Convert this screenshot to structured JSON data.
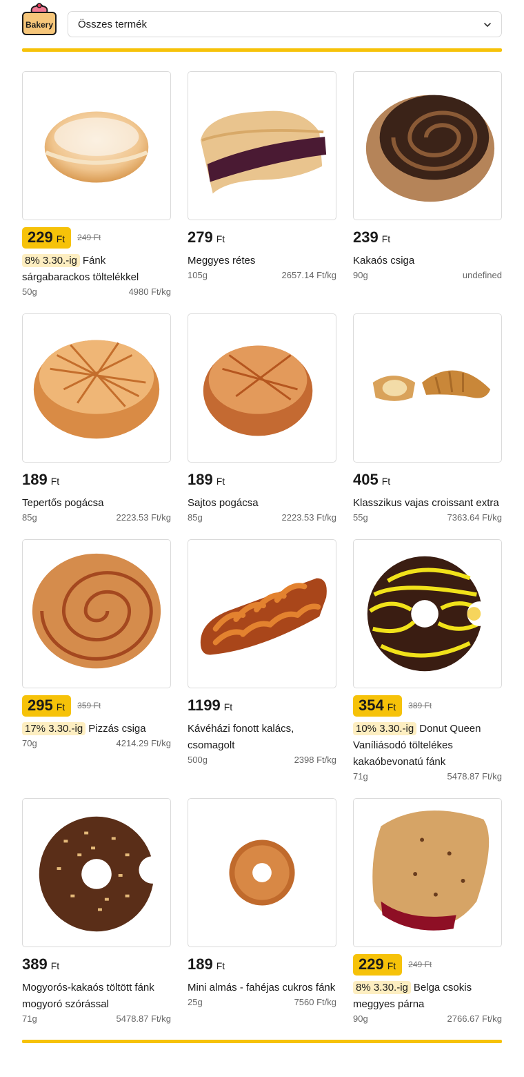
{
  "logo": {
    "text": "Bakery"
  },
  "filter": {
    "selected": "Összes termék"
  },
  "colors": {
    "accent": "#f6c209",
    "discount_bg": "#fdeec1"
  },
  "products": [
    {
      "price": "229",
      "currency": "Ft",
      "old_price": "249 Ft",
      "discount": "8% 3.30.-ig",
      "name": "Fánk sárgabarackos töltelékkel",
      "weight": "50g",
      "unit_price": "4980 Ft/kg"
    },
    {
      "price": "279",
      "currency": "Ft",
      "name": "Meggyes rétes",
      "weight": "105g",
      "unit_price": "2657.14 Ft/kg"
    },
    {
      "price": "239",
      "currency": "Ft",
      "name": "Kakaós csiga",
      "weight": "90g",
      "unit_price": "undefined"
    },
    {
      "price": "189",
      "currency": "Ft",
      "name": "Tepertős pogácsa",
      "weight": "85g",
      "unit_price": "2223.53 Ft/kg"
    },
    {
      "price": "189",
      "currency": "Ft",
      "name": "Sajtos pogácsa",
      "weight": "85g",
      "unit_price": "2223.53 Ft/kg"
    },
    {
      "price": "405",
      "currency": "Ft",
      "name": "Klasszikus vajas croissant extra",
      "weight": "55g",
      "unit_price": "7363.64 Ft/kg"
    },
    {
      "price": "295",
      "currency": "Ft",
      "old_price": "359 Ft",
      "discount": "17% 3.30.-ig",
      "name": "Pizzás csiga",
      "weight": "70g",
      "unit_price": "4214.29 Ft/kg"
    },
    {
      "price": "1199",
      "currency": "Ft",
      "name": "Kávéházi fonott kalács, csomagolt",
      "weight": "500g",
      "unit_price": "2398 Ft/kg"
    },
    {
      "price": "354",
      "currency": "Ft",
      "old_price": "389 Ft",
      "discount": "10% 3.30.-ig",
      "name": "Donut Queen Vaníliásodó töltelékes kakaóbevonatú fánk",
      "weight": "71g",
      "unit_price": "5478.87 Ft/kg"
    },
    {
      "price": "389",
      "currency": "Ft",
      "name": "Mogyorós-kakaós töltött fánk mogyoró szórással",
      "weight": "71g",
      "unit_price": "5478.87 Ft/kg"
    },
    {
      "price": "189",
      "currency": "Ft",
      "name": "Mini almás - fahéjas cukros fánk",
      "weight": "25g",
      "unit_price": "7560 Ft/kg"
    },
    {
      "price": "229",
      "currency": "Ft",
      "old_price": "249 Ft",
      "discount": "8% 3.30.-ig",
      "name": "Belga csokis meggyes párna",
      "weight": "90g",
      "unit_price": "2766.67 Ft/kg"
    }
  ]
}
